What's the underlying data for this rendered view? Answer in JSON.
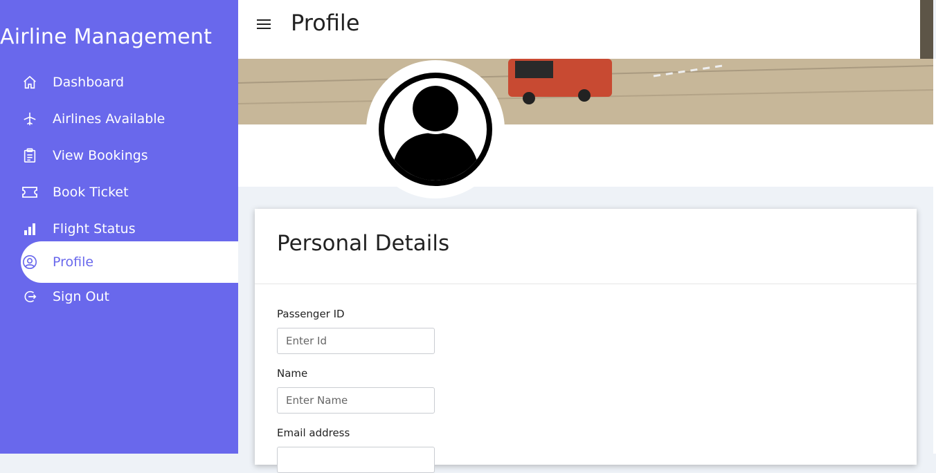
{
  "sidebar": {
    "brand": "Airline Management",
    "items": [
      {
        "label": "Dashboard",
        "icon": "home-icon"
      },
      {
        "label": "Airlines Available",
        "icon": "airplane-icon"
      },
      {
        "label": "View Bookings",
        "icon": "clipboard-icon"
      },
      {
        "label": "Book Ticket",
        "icon": "ticket-icon"
      },
      {
        "label": "Flight Status",
        "icon": "bar-chart-icon"
      },
      {
        "label": "Profile",
        "icon": "user-circle-icon",
        "active": true
      },
      {
        "label": "Sign Out",
        "icon": "sign-out-icon"
      }
    ]
  },
  "topbar": {
    "title": "Profile",
    "menu_icon": "hamburger-icon"
  },
  "card": {
    "title": "Personal Details",
    "fields": [
      {
        "label": "Passenger ID",
        "placeholder": "Enter Id"
      },
      {
        "label": "Name",
        "placeholder": "Enter Name"
      },
      {
        "label": "Email address",
        "placeholder": ""
      }
    ]
  },
  "colors": {
    "sidebar_bg": "#6968ec",
    "page_bg": "#eef2f7"
  }
}
